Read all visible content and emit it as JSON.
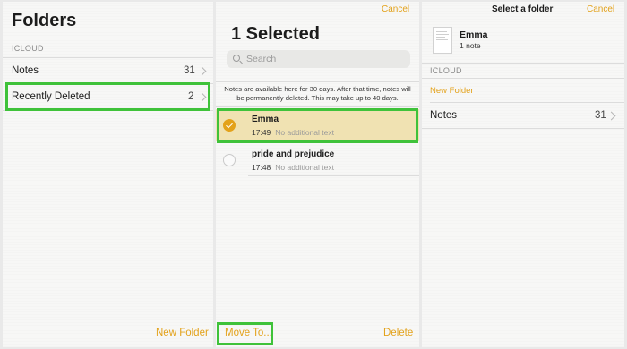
{
  "folders_panel": {
    "title": "Folders",
    "section": "ICLOUD",
    "items": [
      {
        "label": "Notes",
        "count": "31"
      },
      {
        "label": "Recently Deleted",
        "count": "2"
      }
    ],
    "new_folder": "New Folder"
  },
  "selection_panel": {
    "cancel": "Cancel",
    "title": "1 Selected",
    "search_placeholder": "Search",
    "notice": "Notes are available here for 30 days. After that time, notes will be permanently deleted. This may take up to 40 days.",
    "notes": [
      {
        "title": "Emma",
        "time": "17:49",
        "subtitle": "No additional text",
        "selected": true
      },
      {
        "title": "pride and prejudice",
        "time": "17:48",
        "subtitle": "No additional text",
        "selected": false
      }
    ],
    "move_to": "Move To...",
    "delete": "Delete"
  },
  "destination_panel": {
    "title": "Select a folder",
    "cancel": "Cancel",
    "note_title": "Emma",
    "note_count": "1 note",
    "section": "ICLOUD",
    "new_folder": "New Folder",
    "folders": [
      {
        "label": "Notes",
        "count": "31"
      }
    ]
  },
  "colors": {
    "accent": "#e3a21b",
    "highlight_box": "#3fc23a",
    "selected_row": "#f0e2b2"
  }
}
